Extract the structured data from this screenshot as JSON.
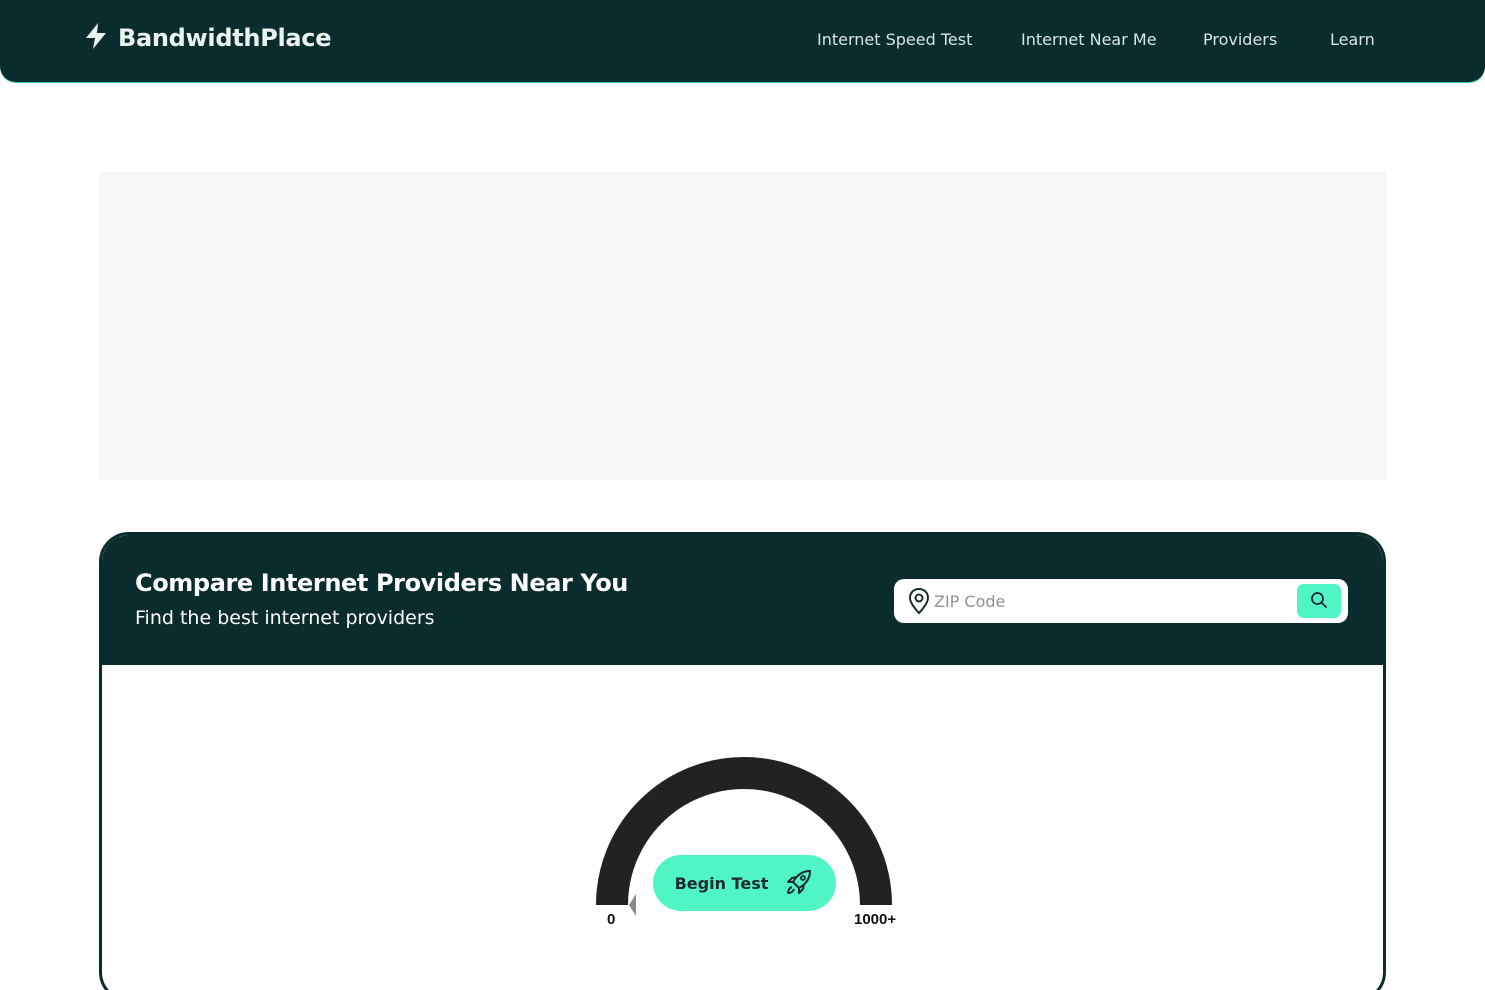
{
  "header": {
    "logo_text": "BandwidthPlace",
    "nav": [
      {
        "label": "Internet Speed Test"
      },
      {
        "label": "Internet Near Me"
      },
      {
        "label": "Providers"
      },
      {
        "label": "Learn"
      }
    ]
  },
  "compare": {
    "title": "Compare Internet Providers Near You",
    "subtitle": "Find the best internet providers",
    "zip_placeholder": "ZIP Code",
    "zip_value": ""
  },
  "speed_test": {
    "begin_label": "Begin Test",
    "gauge_min": "0",
    "gauge_max": "1000+"
  },
  "colors": {
    "brand_dark": "#0b2c2d",
    "accent": "#50f5c5",
    "ad_bg": "#f6f7f9"
  },
  "icons": [
    "bolt-icon",
    "map-pin-icon",
    "search-icon",
    "rocket-icon",
    "needle-icon"
  ]
}
